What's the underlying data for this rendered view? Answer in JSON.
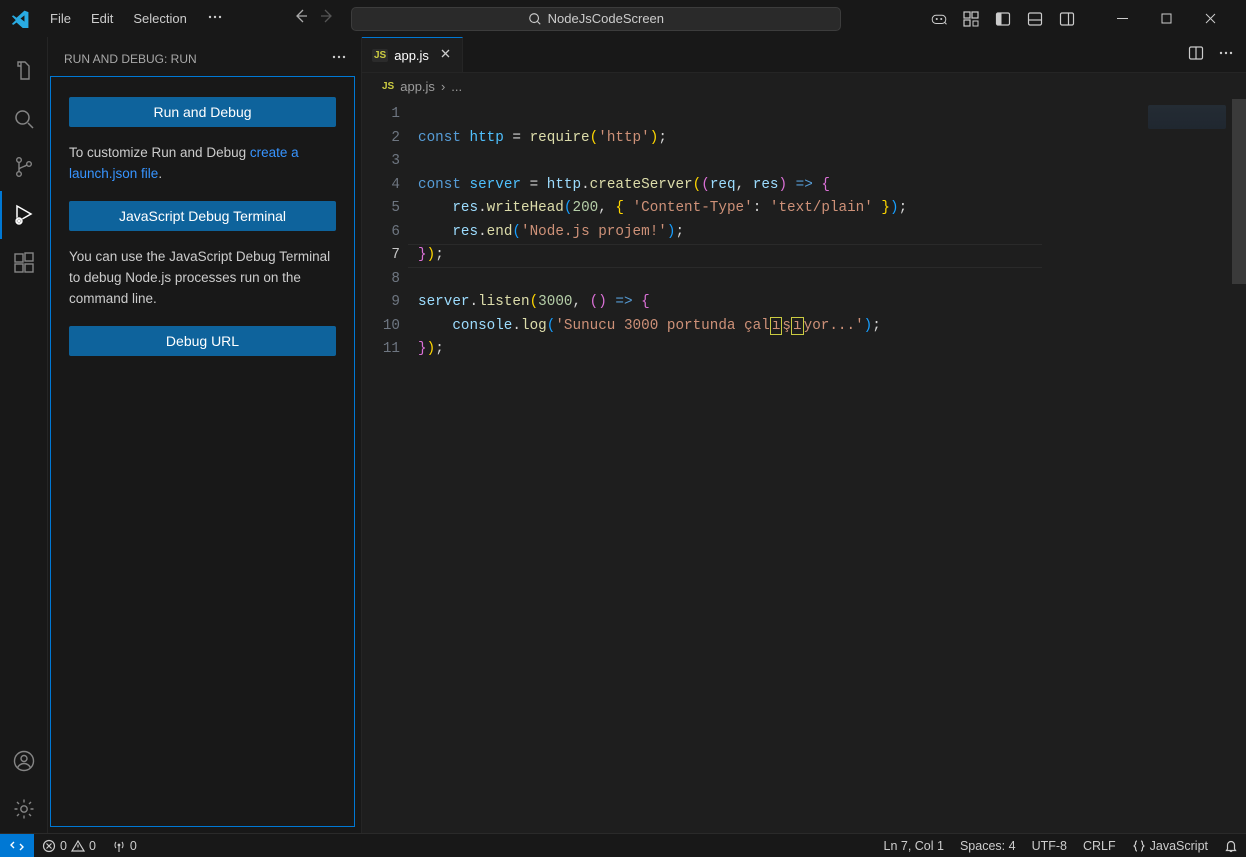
{
  "menu": {
    "file": "File",
    "edit": "Edit",
    "selection": "Selection"
  },
  "search": {
    "text": "NodeJsCodeScreen"
  },
  "sidebar": {
    "title": "RUN AND DEBUG: RUN",
    "runBtn": "Run and Debug",
    "customizePre": "To customize Run and Debug ",
    "customizeLink": "create a launch.json file",
    "customizePost": ".",
    "jsTermBtn": "JavaScript Debug Terminal",
    "jsTermText": "You can use the JavaScript Debug Terminal to debug Node.js processes run on the command line.",
    "debugUrlBtn": "Debug URL"
  },
  "tab": {
    "name": "app.js"
  },
  "breadcrumb": {
    "file": "app.js",
    "sep": "›",
    "more": "..."
  },
  "code": {
    "lines": [
      "1",
      "2",
      "3",
      "4",
      "5",
      "6",
      "7",
      "8",
      "9",
      "10",
      "11"
    ],
    "l1": {
      "const": "const",
      "http": "http",
      "eq": " = ",
      "require": "require",
      "po": "(",
      "s": "'http'",
      "pc": ")",
      "semi": ";"
    },
    "l3": {
      "const": "const",
      "server": "server",
      "eq": " = ",
      "http": "http",
      "dot": ".",
      "create": "createServer",
      "po": "(",
      "po2": "(",
      "req": "req",
      "comma": ", ",
      "res": "res",
      "pc2": ")",
      "arrow": " => ",
      "brace": "{"
    },
    "l4": {
      "indent": "    ",
      "res": "res",
      "dot": ".",
      "write": "writeHead",
      "po": "(",
      "n": "200",
      "comma": ", ",
      "bo": "{",
      "k": " 'Content-Type'",
      "colon": ": ",
      "v": "'text/plain' ",
      "bc": "}",
      "pc": ")",
      "semi": ";"
    },
    "l5": {
      "indent": "    ",
      "res": "res",
      "dot": ".",
      "end": "end",
      "po": "(",
      "s": "'Node.js projem!'",
      "pc": ")",
      "semi": ";"
    },
    "l6": {
      "brace": "}",
      "pc": ")",
      "semi": ";"
    },
    "l8": {
      "server": "server",
      "dot": ".",
      "listen": "listen",
      "po": "(",
      "n": "3000",
      "comma": ", ",
      "po2": "(",
      "pc2": ")",
      "arrow": " => ",
      "brace": "{"
    },
    "l9": {
      "indent": "    ",
      "console": "console",
      "dot": ".",
      "log": "log",
      "po": "(",
      "s1": "'Sunucu 3000 portunda çal",
      "bad1": "ı",
      "s2": "ş",
      "bad2": "ı",
      "s3": "yor...'",
      "pc": ")",
      "semi": ";"
    },
    "l10": {
      "brace": "}",
      "pc": ")",
      "semi": ";"
    }
  },
  "status": {
    "errors": "0",
    "warnings": "0",
    "ports": "0",
    "lncol": "Ln 7, Col 1",
    "spaces": "Spaces: 4",
    "enc": "UTF-8",
    "eol": "CRLF",
    "lang": "JavaScript"
  }
}
